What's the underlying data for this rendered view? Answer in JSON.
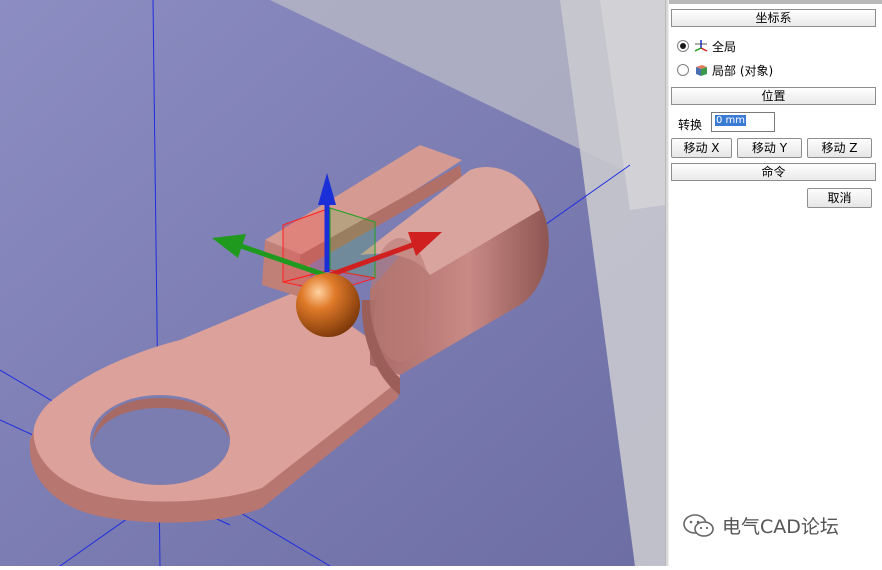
{
  "panel": {
    "coord_system_label": "坐标系",
    "radio_global": "全局",
    "radio_local": "局部 (对象)",
    "position_label": "位置",
    "transform_label": "转换",
    "transform_value": "0 mm",
    "move_x": "移动 X",
    "move_y": "移动 Y",
    "move_z": "移动 Z",
    "command_label": "命令",
    "cancel": "取消",
    "selected_radio": "global"
  },
  "watermark": {
    "text": "电气CAD论坛",
    "icon": "wechat-icon"
  },
  "viewport": {
    "background": "#7b7cb0",
    "part_color": "#d99a90",
    "gizmo_colors": {
      "x": "#d02020",
      "y": "#1f9a1f",
      "z": "#1a2fd8"
    }
  }
}
